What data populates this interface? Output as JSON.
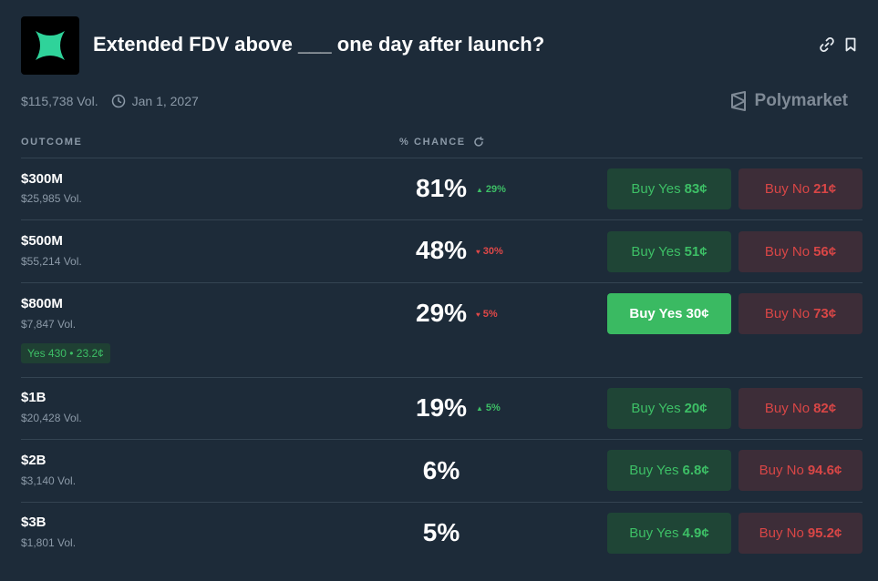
{
  "header": {
    "title": "Extended FDV above ___ one day after launch?",
    "volume": "$115,738 Vol.",
    "end_date": "Jan 1, 2027",
    "brand": "Polymarket"
  },
  "columns": {
    "outcome": "OUTCOME",
    "chance": "% CHANCE"
  },
  "outcomes": [
    {
      "name": "$300M",
      "vol": "$25,985 Vol.",
      "pct": "81%",
      "delta": "29%",
      "delta_dir": "up",
      "yes_label": "Buy Yes",
      "yes_price": "83¢",
      "no_label": "Buy No",
      "no_price": "21¢"
    },
    {
      "name": "$500M",
      "vol": "$55,214 Vol.",
      "pct": "48%",
      "delta": "30%",
      "delta_dir": "down",
      "yes_label": "Buy Yes",
      "yes_price": "51¢",
      "no_label": "Buy No",
      "no_price": "56¢"
    },
    {
      "name": "$800M",
      "vol": "$7,847 Vol.",
      "pct": "29%",
      "delta": "5%",
      "delta_dir": "down",
      "yes_label": "Buy Yes",
      "yes_price": "30¢",
      "no_label": "Buy No",
      "no_price": "73¢",
      "position": "Yes 430 • 23.2¢"
    },
    {
      "name": "$1B",
      "vol": "$20,428 Vol.",
      "pct": "19%",
      "delta": "5%",
      "delta_dir": "up",
      "yes_label": "Buy Yes",
      "yes_price": "20¢",
      "no_label": "Buy No",
      "no_price": "82¢"
    },
    {
      "name": "$2B",
      "vol": "$3,140 Vol.",
      "pct": "6%",
      "yes_label": "Buy Yes",
      "yes_price": "6.8¢",
      "no_label": "Buy No",
      "no_price": "94.6¢"
    },
    {
      "name": "$3B",
      "vol": "$1,801 Vol.",
      "pct": "5%",
      "yes_label": "Buy Yes",
      "yes_price": "4.9¢",
      "no_label": "Buy No",
      "no_price": "95.2¢"
    }
  ],
  "colors": {
    "background": "#1d2b39",
    "yes": "#3dbf66",
    "no": "#d84646",
    "muted": "#8c9aa8"
  }
}
